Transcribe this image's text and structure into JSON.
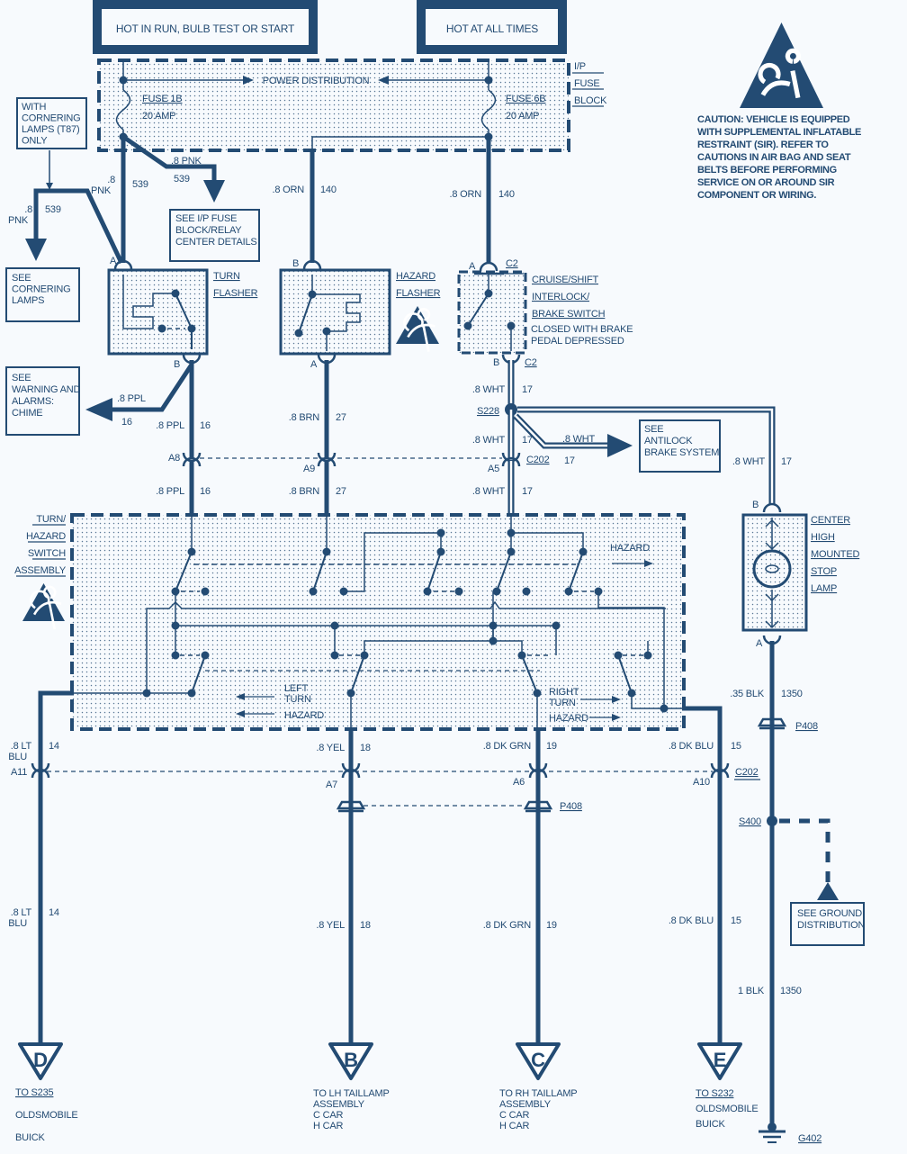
{
  "colors": {
    "ink": "#234b73",
    "background": "#f7fafd",
    "wire_white_core": "#ffffff"
  },
  "power": {
    "hot_run": "HOT IN RUN, BULB TEST OR START",
    "hot_all": "HOT AT ALL TIMES"
  },
  "fuse_block": {
    "title": [
      "I/P",
      "FUSE",
      "BLOCK"
    ],
    "bus": "POWER DISTRIBUTION",
    "fuse1": "FUSE 1B",
    "fuse1_rating": "20 AMP",
    "fuse2": "FUSE 6B",
    "fuse2_rating": "20 AMP"
  },
  "notes": {
    "cornering_option": [
      "WITH",
      "CORNERING",
      "LAMPS (T87)",
      "ONLY"
    ],
    "see_cornering": [
      "SEE",
      "CORNERING",
      "LAMPS"
    ],
    "see_fuse": [
      "SEE I/P FUSE",
      "BLOCK/RELAY",
      "CENTER DETAILS"
    ],
    "see_chime": [
      "SEE",
      "WARNING AND",
      "ALARMS:",
      "CHIME"
    ],
    "see_abs": [
      "SEE",
      "ANTILOCK",
      "BRAKE SYSTEM"
    ],
    "see_ground": [
      "SEE GROUND",
      "DISTRIBUTION"
    ]
  },
  "caution": [
    "CAUTION: VEHICLE IS EQUIPPED",
    "WITH SUPPLEMENTAL INFLATABLE",
    "RESTRAINT (SIR). REFER TO",
    "CAUTIONS IN AIR BAG AND SEAT",
    "BELTS BEFORE PERFORMING",
    "SERVICE ON OR AROUND SIR",
    "COMPONENT OR WIRING."
  ],
  "icons": {
    "caution": "airbag-warning-triangle-icon",
    "ground": "ground-symbol-icon"
  },
  "components": {
    "turn_flasher": [
      "TURN",
      "FLASHER"
    ],
    "hazard_flasher": [
      "HAZARD",
      "FLASHER"
    ],
    "brake_switch": [
      "CRUISE/SHIFT",
      "INTERLOCK/",
      "BRAKE SWITCH"
    ],
    "brake_switch_note": [
      "CLOSED WITH BRAKE",
      "PEDAL DEPRESSED"
    ],
    "switch_assembly": [
      "TURN/",
      "HAZARD",
      "SWITCH",
      "ASSEMBLY"
    ],
    "switch_hazard": "HAZARD",
    "left": [
      "LEFT",
      "TURN",
      "HAZARD"
    ],
    "right": [
      "RIGHT",
      "TURN",
      "HAZARD"
    ],
    "chmsl": [
      "CENTER",
      "HIGH",
      "MOUNTED",
      "STOP",
      "LAMP"
    ]
  },
  "connectors": {
    "turn_a": "A",
    "turn_b": "B",
    "hazard_b": "B",
    "hazard_a": "A",
    "brake_a": "A",
    "brake_c2_top": "C2",
    "brake_b": "B",
    "brake_c2_bot": "C2",
    "a8": "A8",
    "a9": "A9",
    "a5": "A5",
    "c202_top": "C202",
    "chmsl_b": "B",
    "chmsl_a": "A",
    "a11": "A11",
    "a7": "A7",
    "a6": "A6",
    "a10": "A10",
    "c202_bot": "C202",
    "p408_top": "P408",
    "p408_bot": "P408",
    "s228": "S228",
    "s400": "S400",
    "g402": "G402"
  },
  "wires": [
    {
      "gauge_color": [
        ".8",
        "PNK"
      ],
      "circuit": "539"
    },
    {
      "gauge_color": [
        ".8 PNK"
      ],
      "circuit": "539"
    },
    {
      "gauge_color": [
        ".8",
        "PNK"
      ],
      "circuit": "539"
    },
    {
      "gauge_color": [
        ".8 ORN"
      ],
      "circuit": "140"
    },
    {
      "gauge_color": [
        ".8 ORN"
      ],
      "circuit": "140"
    },
    {
      "gauge_color": [
        ".8 PPL"
      ],
      "circuit": "16"
    },
    {
      "gauge_color": [
        ".8 PPL"
      ],
      "circuit": "16"
    },
    {
      "gauge_color": [
        ".8 BRN"
      ],
      "circuit": "27"
    },
    {
      "gauge_color": [
        ".8 WHT"
      ],
      "circuit": "17"
    },
    {
      "gauge_color": [
        ".8 WHT"
      ],
      "circuit": "17"
    },
    {
      "gauge_color": [
        ".8 WHT"
      ],
      "circuit": "17"
    },
    {
      "gauge_color": [
        ".8 WHT"
      ],
      "circuit": "17"
    },
    {
      "gauge_color": [
        ".8 PPL"
      ],
      "circuit": "16"
    },
    {
      "gauge_color": [
        ".8 BRN"
      ],
      "circuit": "27"
    },
    {
      "gauge_color": [
        ".8 WHT"
      ],
      "circuit": "17"
    },
    {
      "gauge_color": [
        ".35 BLK"
      ],
      "circuit": "1350"
    },
    {
      "gauge_color": [
        ".8 LT",
        "BLU"
      ],
      "circuit": "14"
    },
    {
      "gauge_color": [
        ".8 YEL"
      ],
      "circuit": "18"
    },
    {
      "gauge_color": [
        ".8 DK GRN"
      ],
      "circuit": "19"
    },
    {
      "gauge_color": [
        ".8 DK BLU"
      ],
      "circuit": "15"
    },
    {
      "gauge_color": [
        ".8 LT",
        "BLU"
      ],
      "circuit": "14"
    },
    {
      "gauge_color": [
        ".8 YEL"
      ],
      "circuit": "18"
    },
    {
      "gauge_color": [
        ".8 DK GRN"
      ],
      "circuit": "19"
    },
    {
      "gauge_color": [
        ".8 DK BLU"
      ],
      "circuit": "15"
    },
    {
      "gauge_color": [
        "1 BLK"
      ],
      "circuit": "1350"
    }
  ],
  "destinations": [
    {
      "letter": "D",
      "text": [
        "TO S235",
        "OLDSMOBILE",
        "BUICK"
      ]
    },
    {
      "letter": "B",
      "text": [
        "TO LH TAILLAMP",
        "ASSEMBLY",
        "C CAR",
        "H CAR"
      ]
    },
    {
      "letter": "C",
      "text": [
        "TO RH TAILLAMP",
        "ASSEMBLY",
        "C CAR",
        "H CAR"
      ]
    },
    {
      "letter": "E",
      "text": [
        "TO S232",
        "OLDSMOBILE",
        "BUICK"
      ]
    }
  ]
}
